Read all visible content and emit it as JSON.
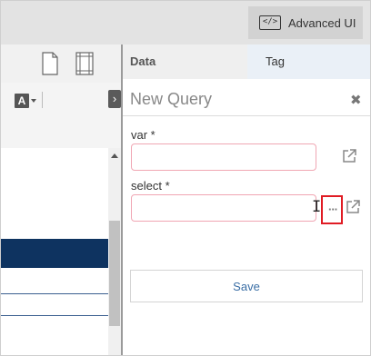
{
  "topbar": {
    "advanced_ui_label": "Advanced UI",
    "advanced_ui_icon": "</>"
  },
  "left_toolbar": {
    "font_icon_letter": "A",
    "collapse_glyph": "›"
  },
  "tabs": [
    {
      "label": "Data"
    },
    {
      "label": "Tag"
    }
  ],
  "query": {
    "title": "New Query",
    "close_glyph": "✖",
    "fields": [
      {
        "label": "var *",
        "value": "",
        "icon": "external-link-icon"
      },
      {
        "label": "select *",
        "value": "",
        "icon": "external-link-icon",
        "extra_button": "···"
      }
    ],
    "save_label": "Save"
  },
  "colors": {
    "accent_navy": "#0e3360",
    "field_border": "#f0a6b3",
    "highlight_red": "#e01c24",
    "link_blue": "#3a6ea5"
  }
}
